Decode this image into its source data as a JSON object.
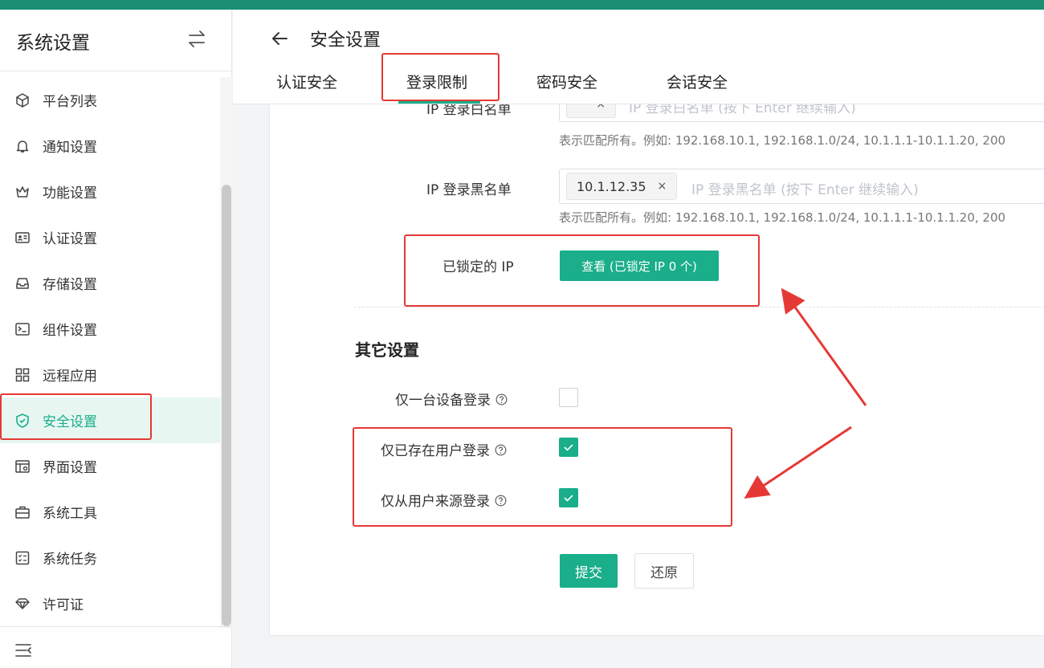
{
  "colors": {
    "brand": "#1aae8a",
    "topbar": "#1a8f73",
    "annotation": "#e53935"
  },
  "sidebar": {
    "title": "系统设置",
    "items": [
      {
        "label": "平台列表",
        "icon": "cube-icon"
      },
      {
        "label": "通知设置",
        "icon": "bell-icon"
      },
      {
        "label": "功能设置",
        "icon": "crown-icon"
      },
      {
        "label": "认证设置",
        "icon": "id-card-icon"
      },
      {
        "label": "存储设置",
        "icon": "inbox-icon"
      },
      {
        "label": "组件设置",
        "icon": "terminal-icon"
      },
      {
        "label": "远程应用",
        "icon": "apps-grid-icon"
      },
      {
        "label": "安全设置",
        "icon": "shield-check-icon",
        "active": true
      },
      {
        "label": "界面设置",
        "icon": "layout-gear-icon"
      },
      {
        "label": "系统工具",
        "icon": "toolbox-icon"
      },
      {
        "label": "系统任务",
        "icon": "task-list-icon"
      },
      {
        "label": "许可证",
        "icon": "diamond-icon"
      }
    ]
  },
  "header": {
    "title": "安全设置",
    "tabs": [
      {
        "label": "认证安全"
      },
      {
        "label": "登录限制",
        "active": true
      },
      {
        "label": "密码安全"
      },
      {
        "label": "会话安全"
      }
    ]
  },
  "form": {
    "whitelist": {
      "label": "IP 登录白名单",
      "tag": "",
      "placeholder": "IP 登录白名单 (按下 Enter 继续输入)",
      "hint": "表示匹配所有。例如: 192.168.10.1, 192.168.1.0/24, 10.1.1.1-10.1.1.20, 200"
    },
    "blacklist": {
      "label": "IP 登录黑名单",
      "tag": "10.1.12.35",
      "placeholder": "IP 登录黑名单 (按下 Enter 继续输入)",
      "hint": "表示匹配所有。例如: 192.168.10.1, 192.168.1.0/24, 10.1.1.1-10.1.1.20, 200"
    },
    "locked_ip": {
      "label": "已锁定的 IP",
      "button": "查看 (已锁定 IP 0 个)"
    },
    "other_section_title": "其它设置",
    "options": [
      {
        "label": "仅一台设备登录",
        "checked": false
      },
      {
        "label": "仅已存在用户登录",
        "checked": true
      },
      {
        "label": "仅从用户来源登录",
        "checked": true
      }
    ],
    "submit": "提交",
    "reset": "还原"
  }
}
